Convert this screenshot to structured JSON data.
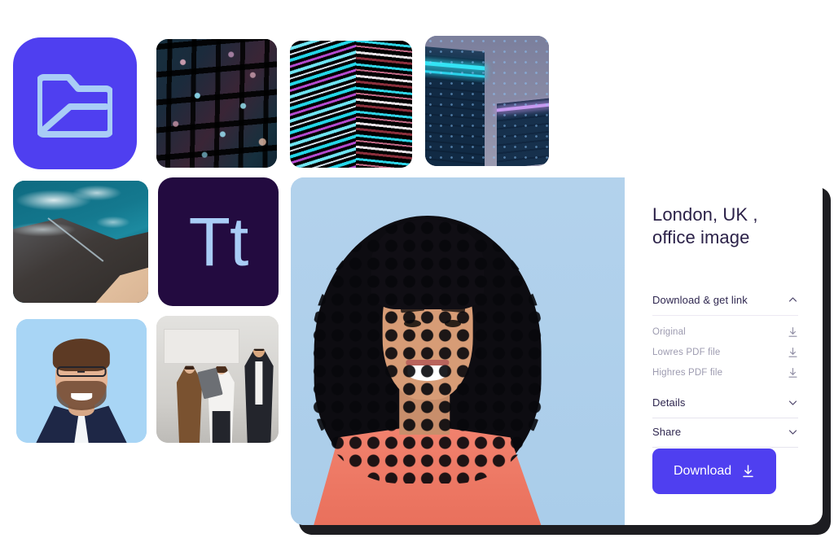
{
  "gallery": {
    "tiles": [
      {
        "name": "folder-icon-tile",
        "kind": "icon",
        "icon": "folder-image-icon",
        "bg": "#4f3ff0",
        "fg": "#a9cdf6"
      },
      {
        "name": "office-windows-thumbnail",
        "kind": "photo",
        "subject": "office building windows at night"
      },
      {
        "name": "neon-waves-thumbnail",
        "kind": "photo",
        "subject": "abstract neon wavy stripes"
      },
      {
        "name": "skyscrapers-thumbnail",
        "kind": "photo",
        "subject": "neon-lit skyscrapers at dusk"
      },
      {
        "name": "coastline-thumbnail",
        "kind": "photo",
        "subject": "aerial view of rocky coastline"
      },
      {
        "name": "typography-tile",
        "kind": "icon",
        "icon": "text-tool-icon",
        "label": "Tt",
        "bg": "#230b40",
        "fg": "#a9cdf6"
      },
      {
        "name": "headshot-thumbnail",
        "kind": "photo",
        "subject": "man with glasses portrait"
      },
      {
        "name": "team-thumbnail",
        "kind": "photo",
        "subject": "three business people with tablet"
      }
    ]
  },
  "detail": {
    "preview_alt": "smiling woman with curly hair on light blue background",
    "title_line1": "London, UK ,",
    "title_line2": "office image",
    "sections": [
      {
        "id": "download-get-link",
        "label": "Download & get link",
        "chevron": "chevron-up-icon",
        "expanded": true,
        "items": [
          {
            "label": "Original",
            "icon": "download-icon"
          },
          {
            "label": "Lowres PDF file",
            "icon": "download-icon"
          },
          {
            "label": "Highres PDF file",
            "icon": "download-icon"
          }
        ]
      },
      {
        "id": "details",
        "label": "Details",
        "chevron": "chevron-down-icon",
        "expanded": false,
        "items": []
      },
      {
        "id": "share",
        "label": "Share",
        "chevron": "chevron-down-icon",
        "expanded": false,
        "items": []
      }
    ],
    "primary_button": {
      "label": "Download",
      "icon": "download-icon",
      "color": "#4f3ff0"
    }
  },
  "theme": {
    "accent": "#4f3ff0",
    "title_color": "#2b2148",
    "muted_text": "#9d9bb0",
    "card_bg": "#ffffff",
    "preview_bg": "#aed0ec"
  }
}
